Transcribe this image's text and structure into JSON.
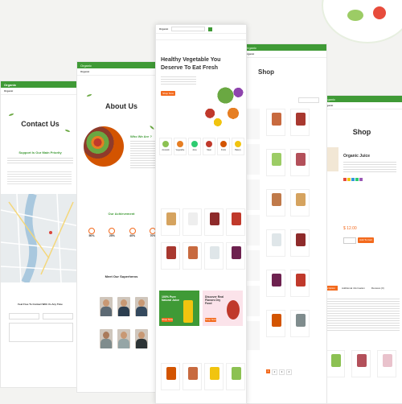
{
  "brand": {
    "name": "Organic",
    "accent": "#3f9a36",
    "orange": "#f36a1d"
  },
  "contact": {
    "title": "Contact Us",
    "subtitle": "Support Is Our Main Priority",
    "form_title": "Feel Free To Contact With Us Any Time"
  },
  "about": {
    "title": "About Us",
    "who_title": "Who We Are ?",
    "achievement_title": "Our Achievement",
    "stats": [
      "50%",
      "25%",
      "40%",
      "70%"
    ],
    "team_title": "Meet Our Superheros"
  },
  "home": {
    "hero_title": "Healthy Vegetable You",
    "hero_title2": "Deserve To Eat Fresh",
    "hero_button": "Shop Now",
    "promo1_title": "100% Pure Natural Juice",
    "promo1_button": "Shop Now",
    "promo2_title": "Discover Real Flavors Dry Food",
    "promo2_button": "Shop Now",
    "categories": [
      "Avocado",
      "Vegetable",
      "Juice",
      "Meat",
      "Fruits",
      "Bakery"
    ]
  },
  "shop": {
    "title": "Shop",
    "pagination": [
      "1",
      "2",
      "3",
      "4"
    ]
  },
  "product": {
    "title": "Shop",
    "name": "Organic Juice",
    "price": "$ 12.00",
    "add_to_cart": "Add To Cart",
    "tabs": [
      "Description",
      "Additional information",
      "Reviews (0)"
    ]
  },
  "icons": [
    "leaf-icon",
    "search-icon",
    "cart-icon",
    "user-icon"
  ]
}
